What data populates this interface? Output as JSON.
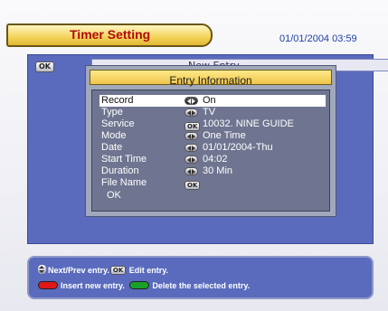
{
  "header": {
    "title": "Timer Setting",
    "datetime": "01/01/2004 03:59"
  },
  "main_panel": {
    "ok_badge": "OK",
    "list_header": "New Entry"
  },
  "dialog": {
    "title": "Entry Information",
    "fields": [
      {
        "label": "Record",
        "control": "arrows-icon",
        "value": "On",
        "selected": true
      },
      {
        "label": "Type",
        "control": "arrows-icon",
        "value": "TV"
      },
      {
        "label": "Service",
        "control": "ok-icon",
        "control_text": "OK",
        "value": "10032. NINE GUIDE"
      },
      {
        "label": "Mode",
        "control": "arrows-icon",
        "value": "One Time"
      },
      {
        "label": "Date",
        "control": "arrows-icon",
        "value": "01/01/2004-Thu"
      },
      {
        "label": "Start Time",
        "control": "arrows-icon",
        "value": "04:02"
      },
      {
        "label": "Duration",
        "control": "arrows-icon",
        "value": "30 Min"
      },
      {
        "label": "File Name",
        "control": "ok-icon",
        "control_text": "OK",
        "value": ""
      }
    ],
    "ok_label": "OK"
  },
  "help": {
    "line1_part1": "Next/Prev entry.",
    "line1_ok": "OK",
    "line1_part2": "Edit entry.",
    "line2_part1": "Insert new entry.",
    "line2_part2": "Delete the selected entry."
  },
  "colors": {
    "panel_blue": "#5a6bbd",
    "title_gold": "#f2d35a",
    "title_text": "#b20a0a",
    "red_key": "#e01818",
    "green_key": "#1aa02a"
  }
}
